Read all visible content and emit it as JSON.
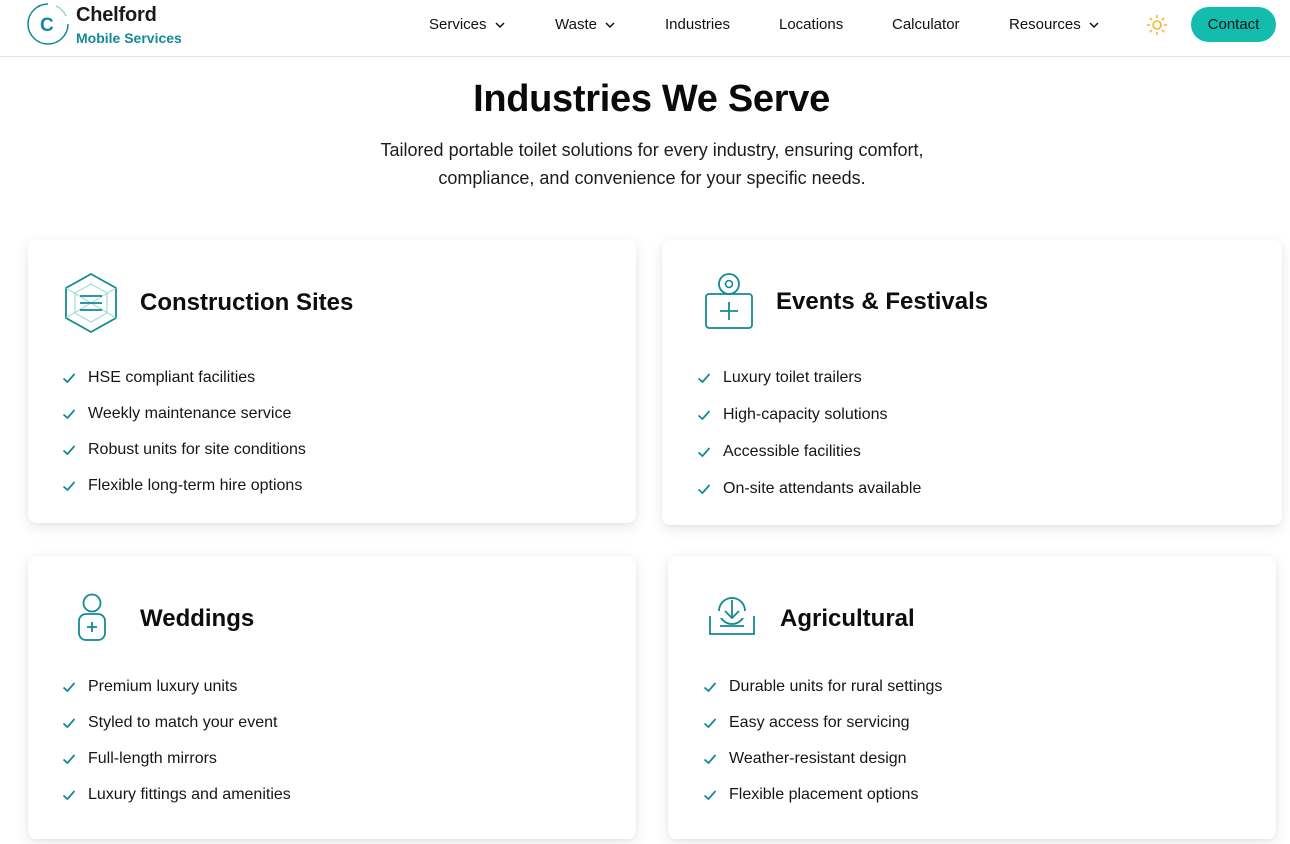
{
  "brand": {
    "name": "Chelford",
    "subtitle": "Mobile Services",
    "mark_letter": "C"
  },
  "nav": {
    "services": "Services",
    "waste": "Waste",
    "industries": "Industries",
    "locations": "Locations",
    "calculator": "Calculator",
    "resources": "Resources",
    "contact": "Contact"
  },
  "hero": {
    "title": "Industries We Serve",
    "subtitle": "Tailored portable toilet solutions for every industry, ensuring comfort, compliance, and convenience for your specific needs."
  },
  "cards": [
    {
      "icon": "hexagon-box-icon",
      "title": "Construction Sites",
      "features": [
        "HSE compliant facilities",
        "Weekly maintenance service",
        "Robust units for site conditions",
        "Flexible long-term hire options"
      ]
    },
    {
      "icon": "medical-bag-icon",
      "title": "Events & Festivals",
      "features": [
        "Luxury toilet trailers",
        "High-capacity solutions",
        "Accessible facilities",
        "On-site attendants available"
      ]
    },
    {
      "icon": "person-plus-icon",
      "title": "Weddings",
      "features": [
        "Premium luxury units",
        "Styled to match your event",
        "Full-length mirrors",
        "Luxury fittings and amenities"
      ]
    },
    {
      "icon": "download-tray-icon",
      "title": "Agricultural",
      "features": [
        "Durable units for rural settings",
        "Easy access for servicing",
        "Weather-resistant design",
        "Flexible placement options"
      ]
    }
  ],
  "colors": {
    "accent": "#14bcae",
    "icon": "#138a96",
    "sun": "#f2b632"
  }
}
